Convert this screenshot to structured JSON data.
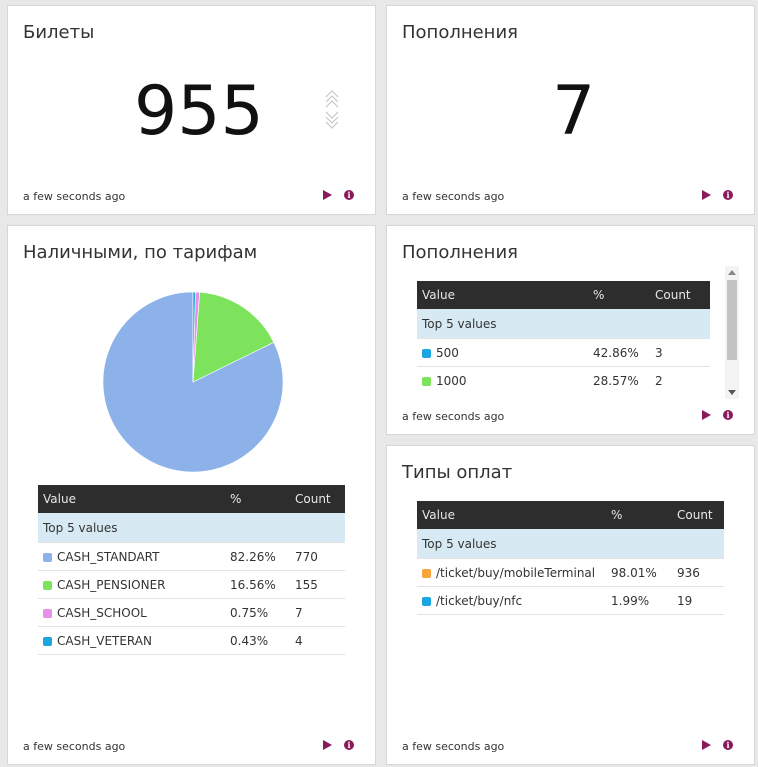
{
  "panels": {
    "tickets": {
      "title": "Билеты",
      "value": "955",
      "updated": "a few seconds ago"
    },
    "topups_count": {
      "title": "Пополнения",
      "value": "7",
      "updated": "a few seconds ago"
    },
    "cash_tariffs": {
      "title": "Наличными, по тарифам",
      "updated": "a few seconds ago",
      "table": {
        "headers": [
          "Value",
          "%",
          "Count"
        ],
        "section": "Top 5 values",
        "rows": [
          {
            "color": "#8db2ea",
            "value": "CASH_STANDART",
            "pct": "82.26%",
            "count": "770"
          },
          {
            "color": "#7ee35c",
            "value": "CASH_PENSIONER",
            "pct": "16.56%",
            "count": "155"
          },
          {
            "color": "#e88fe8",
            "value": "CASH_SCHOOL",
            "pct": "0.75%",
            "count": "7"
          },
          {
            "color": "#1aa6de",
            "value": "CASH_VETERAN",
            "pct": "0.43%",
            "count": "4"
          }
        ]
      }
    },
    "topups_table": {
      "title": "Пополнения",
      "updated": "a few seconds ago",
      "table": {
        "headers": [
          "Value",
          "%",
          "Count"
        ],
        "section": "Top 5 values",
        "rows": [
          {
            "color": "#1aa6de",
            "value": "500",
            "pct": "42.86%",
            "count": "3"
          },
          {
            "color": "#7ee35c",
            "value": "1000",
            "pct": "28.57%",
            "count": "2"
          }
        ]
      }
    },
    "payment_types": {
      "title": "Типы оплат",
      "updated": "a few seconds ago",
      "table": {
        "headers": [
          "Value",
          "%",
          "Count"
        ],
        "section": "Top 5 values",
        "rows": [
          {
            "color": "#f7a43a",
            "value": "/ticket/buy/mobileTerminal",
            "pct": "98.01%",
            "count": "936"
          },
          {
            "color": "#1aa6de",
            "value": "/ticket/buy/nfc",
            "pct": "1.99%",
            "count": "19"
          }
        ]
      }
    }
  },
  "chart_data": {
    "type": "pie",
    "categories": [
      "CASH_STANDART",
      "CASH_PENSIONER",
      "CASH_SCHOOL",
      "CASH_VETERAN"
    ],
    "values": [
      770,
      155,
      7,
      4
    ],
    "colors": [
      "#8db2ea",
      "#7ee35c",
      "#e88fe8",
      "#1aa6de"
    ]
  },
  "icons": {
    "play": "play-icon",
    "info": "info-icon",
    "trend": "double-chevron-icon"
  },
  "colors": {
    "accent": "#8b1a5a",
    "table_header": "#2d2d2d",
    "section_row": "#d7eaf4"
  }
}
